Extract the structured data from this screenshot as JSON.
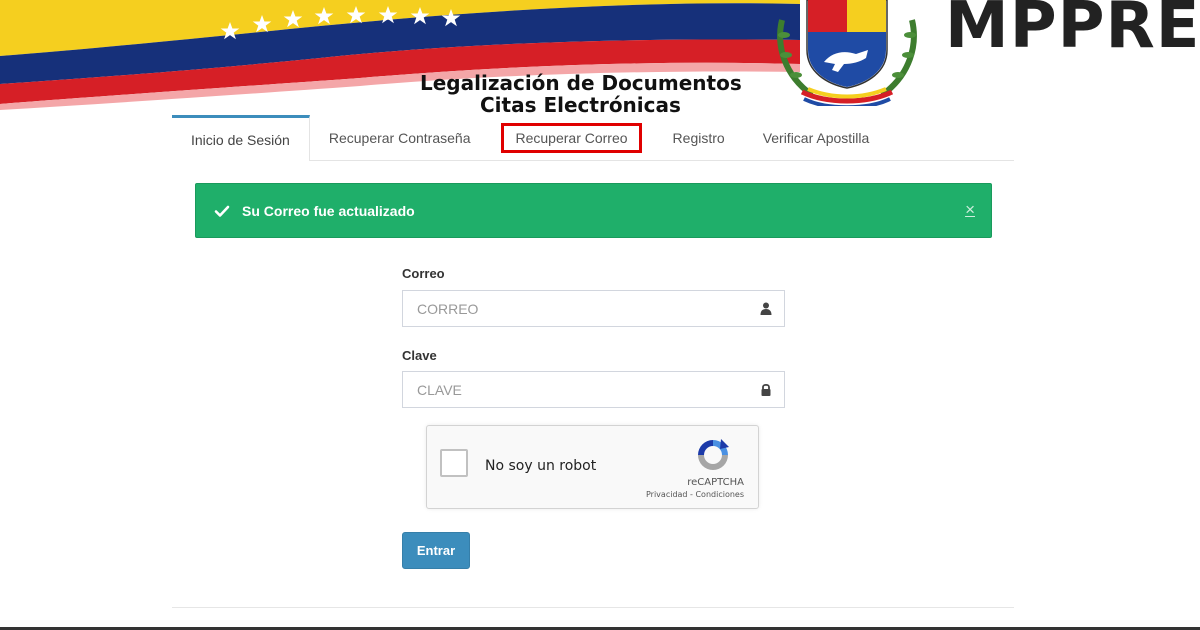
{
  "header": {
    "brand": "MPPRE",
    "title_line1": "Legalización de Documentos",
    "title_line2": "Citas Electrónicas"
  },
  "tabs": [
    {
      "label": "Inicio de Sesión",
      "active": true
    },
    {
      "label": "Recuperar Contraseña",
      "active": false
    },
    {
      "label": "Recuperar Correo",
      "active": false,
      "highlighted": true
    },
    {
      "label": "Registro",
      "active": false
    },
    {
      "label": "Verificar Apostilla",
      "active": false
    }
  ],
  "alert": {
    "message": "Su Correo fue actualizado",
    "close": "×"
  },
  "form": {
    "email_label": "Correo",
    "email_placeholder": "CORREO",
    "password_label": "Clave",
    "password_placeholder": "CLAVE",
    "submit_label": "Entrar"
  },
  "captcha": {
    "label": "No soy un robot",
    "brand": "reCAPTCHA",
    "links": "Privacidad - Condiciones"
  },
  "colors": {
    "accent": "#3c8dbc",
    "success": "#1faf6a",
    "highlight_border": "#e00000",
    "flag_yellow": "#f5cf1f",
    "flag_blue": "#16307a",
    "flag_red": "#d61f26"
  }
}
